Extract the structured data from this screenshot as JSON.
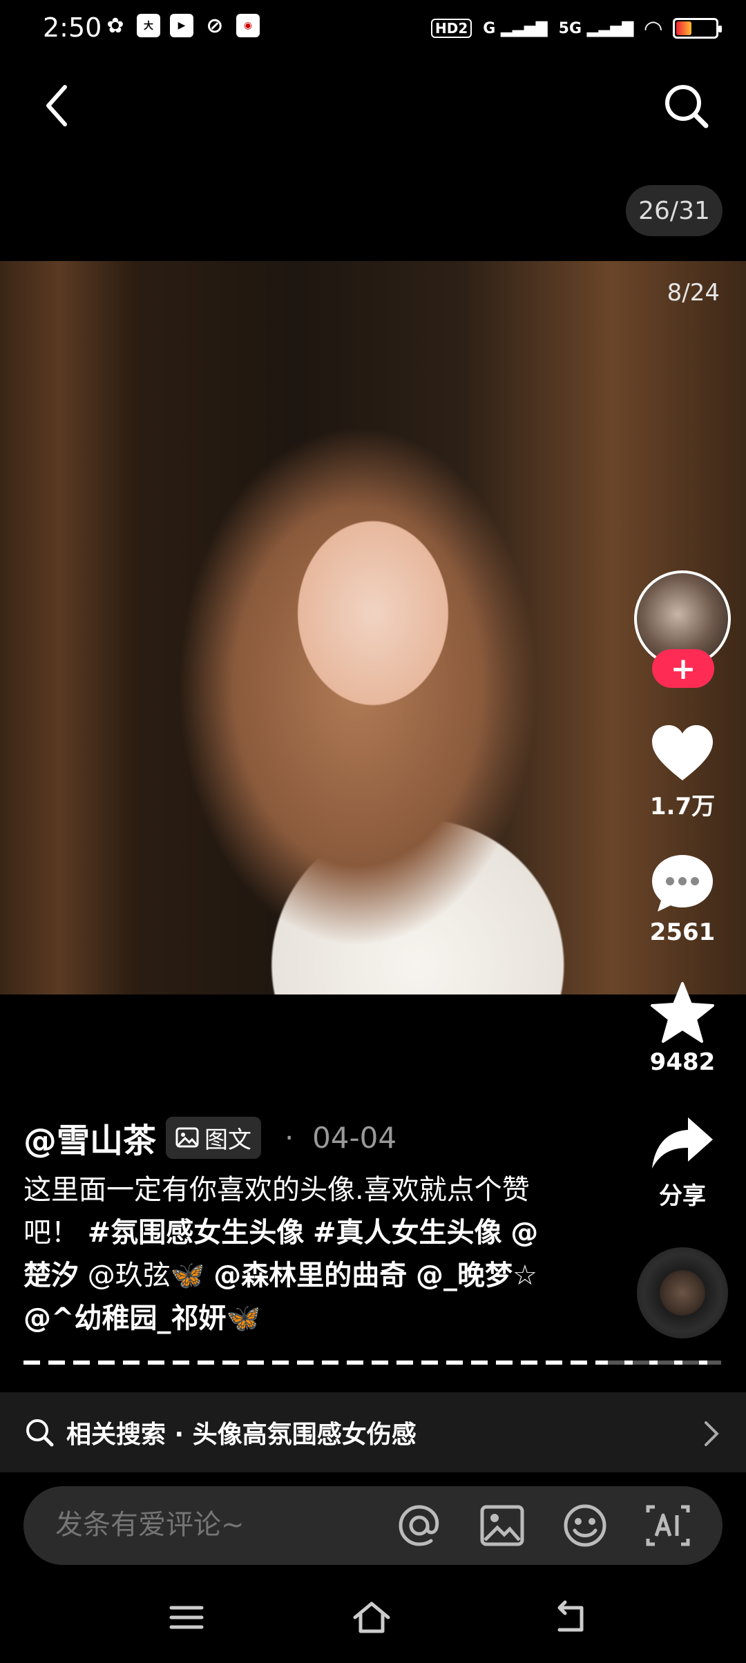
{
  "status_bar": {
    "time": "2:50",
    "hd": "HD2",
    "signal1": "G",
    "signal2": "5G"
  },
  "header": {
    "page_counter": "26/31"
  },
  "photo": {
    "counter": "8/24"
  },
  "rail": {
    "follow": "+",
    "likes": "1.7万",
    "comments": "2561",
    "favorites": "9482",
    "share": "分享"
  },
  "post": {
    "author": "@雪山茶",
    "type_badge": "图文",
    "dot": "·",
    "date": "04-04",
    "caption_text": "这里面一定有你喜欢的头像.喜欢就点个赞吧！",
    "hashtag1": "#氛围感女生头像",
    "hashtag2": "#真人女生头像",
    "mention1": "@楚汐",
    "mention2": "@玖弦🦋",
    "mention3": "@森林里的曲奇",
    "mention4": "@_晚梦☆",
    "mention5": "@^幼稚园_祁妍🦋"
  },
  "related": {
    "label": "相关搜索 · 头像高氛围感女伤感"
  },
  "comment": {
    "placeholder": "发条有爱评论~"
  },
  "colors": {
    "accent": "#fe2c55",
    "background": "#000000"
  }
}
